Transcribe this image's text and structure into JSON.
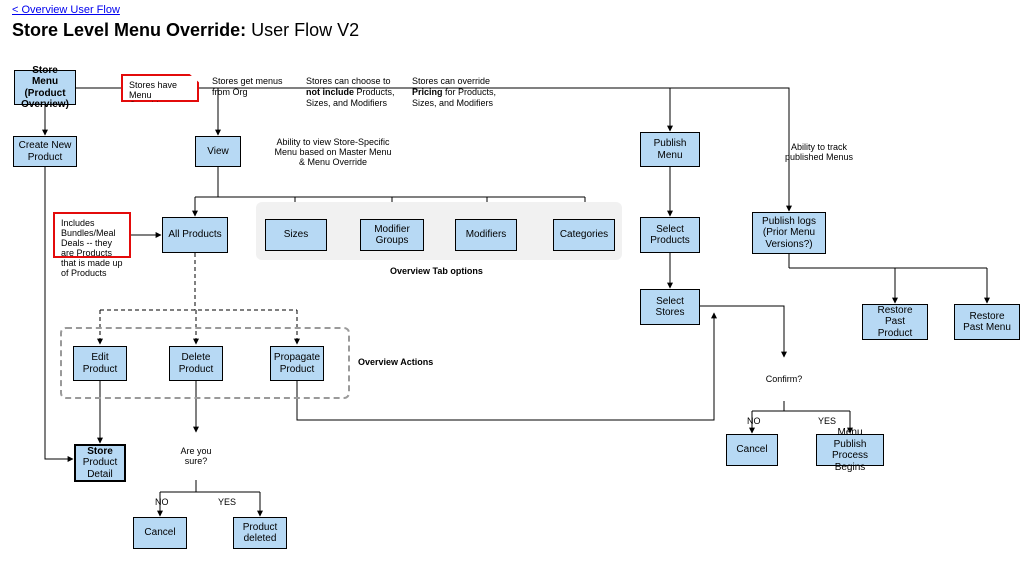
{
  "breadcrumb": "< Overview User Flow",
  "title_bold": "Store Level Menu Override:",
  "title_light": " User Flow V2",
  "notes": {
    "n1": "Stores get menus from Org",
    "n2_a": "Stores can choose to ",
    "n2_b": "not include",
    "n2_c": " Products, Sizes, and Modifiers",
    "n3_a": "Stores can override ",
    "n3_b": "Pricing",
    "n3_c": " for Products, Sizes, and Modifiers"
  },
  "callouts": {
    "overrides": "Stores have Menu Overrides",
    "bundles": "Includes Bundles/Meal Deals -- they are Products that is made up of Products"
  },
  "traps": {
    "view": "Ability to view Store-Specific Menu based on Master Menu & Menu Override",
    "track": "Ability to track published Menus"
  },
  "boxes": {
    "storeMenu": "Store Menu (Product Overview)",
    "createNew": "Create New Product",
    "view": "View",
    "all": "All Products",
    "sizes": "Sizes",
    "modGroups": "Modifier Groups",
    "modifiers": "Modifiers",
    "categories": "Categories",
    "edit": "Edit Product",
    "delete": "Delete Product",
    "propagate": "Propagate Product",
    "storeDetail_a": "Store",
    "storeDetail_b": "Product Detail",
    "cancel1": "Cancel",
    "deleted": "Product deleted",
    "publish": "Publish Menu",
    "selProducts": "Select Products",
    "selStores": "Select Stores",
    "cancel2": "Cancel",
    "begins": "Menu Publish Process Begins",
    "logs": "Publish logs (Prior Menu Versions?)",
    "restoreProduct": "Restore Past Product",
    "restoreMenu": "Restore Past Menu"
  },
  "diamonds": {
    "sure": "Are you sure?",
    "confirm": "Confirm?"
  },
  "labels": {
    "overviewTabs": "Overview Tab options",
    "overviewActions": "Overview Actions",
    "no": "NO",
    "yes": "YES"
  }
}
